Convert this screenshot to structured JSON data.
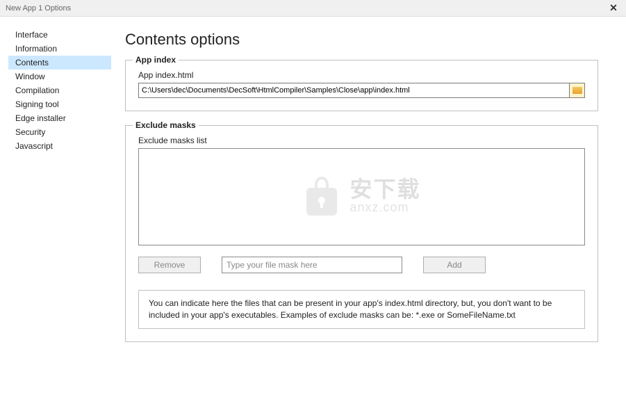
{
  "titlebar": {
    "title": "New App 1 Options",
    "close": "✕"
  },
  "sidebar": {
    "items": [
      {
        "label": "Interface",
        "selected": false
      },
      {
        "label": "Information",
        "selected": false
      },
      {
        "label": "Contents",
        "selected": true
      },
      {
        "label": "Window",
        "selected": false
      },
      {
        "label": "Compilation",
        "selected": false
      },
      {
        "label": "Signing tool",
        "selected": false
      },
      {
        "label": "Edge installer",
        "selected": false
      },
      {
        "label": "Security",
        "selected": false
      },
      {
        "label": "Javascript",
        "selected": false
      }
    ]
  },
  "main": {
    "title": "Contents options",
    "appIndex": {
      "legend": "App index",
      "label": "App index.html",
      "value": "C:\\Users\\dec\\Documents\\DecSoft\\HtmlCompiler\\Samples\\Close\\app\\index.html"
    },
    "excludeMasks": {
      "legend": "Exclude masks",
      "listLabel": "Exclude masks list",
      "removeLabel": "Remove",
      "maskPlaceholder": "Type your file mask here",
      "addLabel": "Add",
      "info": "You can indicate here the files that can be present in your app's index.html directory, but, you don't want to be included in your app's executables. Examples of exclude masks can be: *.exe or SomeFileName.txt"
    },
    "watermark": {
      "cn": "安下载",
      "en": "anxz.com"
    }
  }
}
